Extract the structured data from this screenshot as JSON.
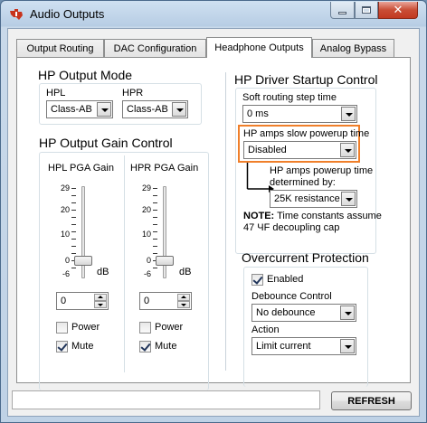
{
  "window": {
    "title": "Audio Outputs"
  },
  "tabs": [
    {
      "label": "Output Routing"
    },
    {
      "label": "DAC Configuration"
    },
    {
      "label": "Headphone Outputs"
    },
    {
      "label": "Analog Bypass"
    }
  ],
  "active_tab": "Headphone Outputs",
  "hp_output_mode": {
    "title": "HP Output Mode",
    "hpl": {
      "label": "HPL",
      "value": "Class-AB"
    },
    "hpr": {
      "label": "HPR",
      "value": "Class-AB"
    }
  },
  "hp_gain": {
    "title": "HP Output Gain Control",
    "hpl": {
      "label": "HPL PGA Gain",
      "value": "0",
      "slider_value": 0,
      "power_label": "Power",
      "power_checked": false,
      "mute_label": "Mute",
      "mute_checked": true
    },
    "hpr": {
      "label": "HPR PGA Gain",
      "value": "0",
      "slider_value": 0,
      "power_label": "Power",
      "power_checked": false,
      "mute_label": "Mute",
      "mute_checked": true
    },
    "ticks": [
      "29",
      "20",
      "10",
      "0",
      "-6"
    ],
    "unit": "dB"
  },
  "hp_driver": {
    "title": "HP Driver Startup Control",
    "soft_step_label": "Soft routing step time",
    "soft_step_value": "0 ms",
    "slow_powerup_label": "HP amps slow powerup time",
    "slow_powerup_value": "Disabled",
    "powerup_determined_label_1": "HP amps powerup time",
    "powerup_determined_label_2": "determined by:",
    "powerup_determined_value": "25K resistance",
    "note_bold": "NOTE:",
    "note_text_1": " Time constants assume",
    "note_text_2": "47 ЧF decoupling cap",
    "highlight_color": "#f07f2a"
  },
  "overcurrent": {
    "title": "Overcurrent Protection",
    "enabled_label": "Enabled",
    "enabled_checked": true,
    "debounce_label": "Debounce Control",
    "debounce_value": "No debounce",
    "action_label": "Action",
    "action_value": "Limit current"
  },
  "footer": {
    "status_text": "",
    "refresh_label": "REFRESH"
  }
}
